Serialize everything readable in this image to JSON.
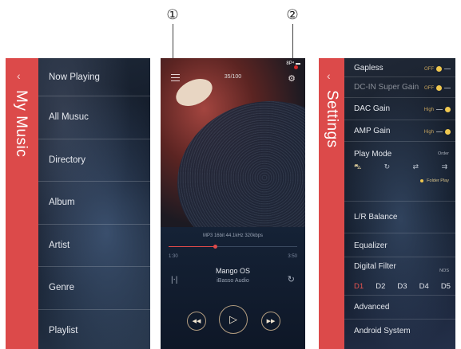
{
  "callouts": [
    "①",
    "②"
  ],
  "my_music": {
    "title": "My Music",
    "back_icon": "chevron-left",
    "items": [
      "Now Playing",
      "All Musuc",
      "Directory",
      "Album",
      "Artist",
      "Genre",
      "Playlist"
    ]
  },
  "player": {
    "status": "8P⁴ ▬",
    "track_count": "35/100",
    "format": "MP3 16bit 44.1kHz 320kbps",
    "progress": 0.36,
    "time_elapsed": "1:30",
    "time_total": "3:50",
    "song_title": "Mango OS",
    "artist": "iBasso Audio",
    "icons": {
      "menu": "hamburger",
      "settings": "gear",
      "eq": "equalizer",
      "repeat": "repeat",
      "prev": "previous",
      "play": "play",
      "next": "next"
    }
  },
  "settings": {
    "title": "Settings",
    "gapless": {
      "label": "Gapless",
      "state": "OFF"
    },
    "dc_in": {
      "label": "DC-IN Super Gain",
      "state": "OFF"
    },
    "dac_gain": {
      "label": "DAC Gain",
      "state": "High"
    },
    "amp_gain": {
      "label": "AMP Gain",
      "state": "High"
    },
    "play_mode": {
      "label": "Play Mode",
      "order": "Order",
      "folder": "Folder Play"
    },
    "lr_balance": "L/R Balance",
    "equalizer": "Equalizer",
    "digital_filter": {
      "label": "Digital Filter",
      "mode": "NOS",
      "options": [
        "D1",
        "D2",
        "D3",
        "D4",
        "D5"
      ],
      "selected": "D1"
    },
    "advanced": "Advanced",
    "android_system": "Android System"
  },
  "colors": {
    "accent": "#dc4a4a",
    "progress": "#e04a4a",
    "toggle": "#f0c84f"
  }
}
